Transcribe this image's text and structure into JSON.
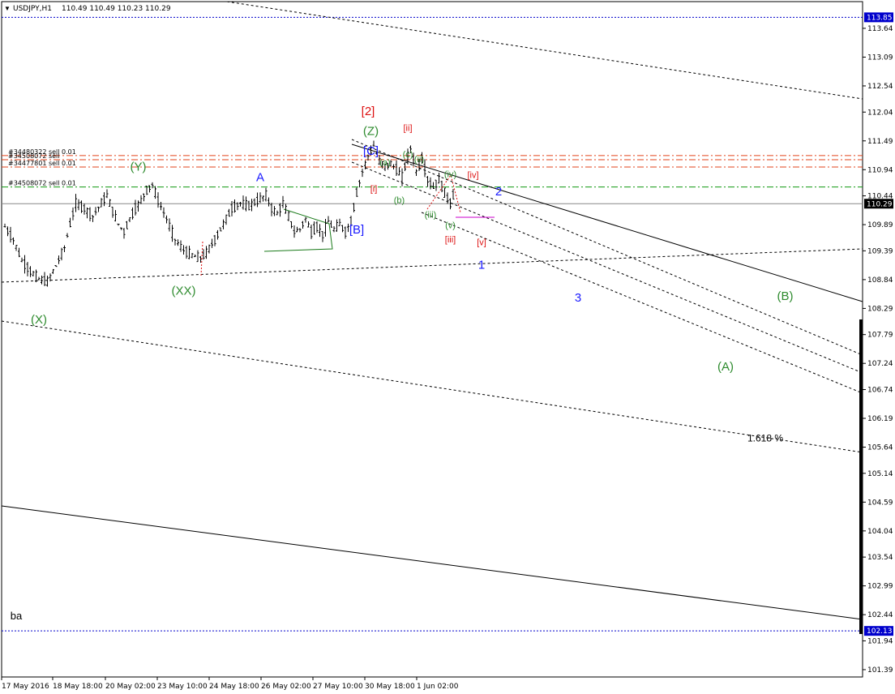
{
  "header": {
    "arrow": "▼",
    "symbol": "USDJPY,H1",
    "ohlc": "110.49 110.49 110.23 110.29"
  },
  "colors": {
    "background": "#ffffff",
    "text": "#000000",
    "price_tag": "#0000cc",
    "wave_green": "#2e8b2e",
    "wave_blue": "#1a1aff",
    "wave_red": "#dd1111",
    "wave_magenta": "#cc00cc",
    "order_line": "#e2431b",
    "order_line_green": "#119911"
  },
  "chart_data": {
    "type": "candlestick",
    "title": "USDJPY,H1",
    "ylim": [
      101.25,
      114.15
    ],
    "y_ticks": [
      "113.64",
      "113.09",
      "112.54",
      "112.04",
      "111.49",
      "110.94",
      "110.44",
      "109.89",
      "109.39",
      "108.84",
      "108.29",
      "107.79",
      "107.24",
      "106.74",
      "106.19",
      "105.64",
      "105.14",
      "104.59",
      "104.04",
      "103.54",
      "102.99",
      "102.44",
      "101.94",
      "101.39"
    ],
    "x_ticks": [
      "17 May 2016",
      "18 May 18:00",
      "20 May 02:00",
      "23 May 10:00",
      "24 May 18:00",
      "26 May 02:00",
      "27 May 10:00",
      "30 May 18:00",
      "1 Jun 02:00"
    ],
    "current_price": "110.29",
    "price_tags": [
      {
        "label": "113.85",
        "value": 113.85
      },
      {
        "label": "110.29",
        "value": 110.29
      },
      {
        "label": "102.13",
        "value": 102.13
      }
    ],
    "orders": [
      {
        "label": "#34480322 sell 0.01",
        "price": 111.21
      },
      {
        "label": "#34508072 sell",
        "price": 111.13
      },
      {
        "label": "#34477801 sell 0.01",
        "price": 110.99
      },
      {
        "label": "#34508072 sell 0.01",
        "price": 110.61
      }
    ],
    "price_path": [
      [
        0,
        109.85
      ],
      [
        3,
        109.6
      ],
      [
        6,
        109.2
      ],
      [
        9,
        109.0
      ],
      [
        12,
        108.85
      ],
      [
        15,
        108.8
      ],
      [
        18,
        109.1
      ],
      [
        21,
        109.45
      ],
      [
        23,
        109.9
      ],
      [
        25,
        110.3
      ],
      [
        28,
        110.2
      ],
      [
        31,
        110.05
      ],
      [
        34,
        110.3
      ],
      [
        36,
        110.45
      ],
      [
        38,
        110.15
      ],
      [
        40,
        109.9
      ],
      [
        42,
        109.75
      ],
      [
        44,
        110.0
      ],
      [
        46,
        110.2
      ],
      [
        48,
        110.35
      ],
      [
        50,
        110.55
      ],
      [
        52,
        110.65
      ],
      [
        54,
        110.35
      ],
      [
        57,
        110.0
      ],
      [
        60,
        109.6
      ],
      [
        63,
        109.4
      ],
      [
        66,
        109.3
      ],
      [
        69,
        109.25
      ],
      [
        71,
        109.35
      ],
      [
        74,
        109.6
      ],
      [
        77,
        109.9
      ],
      [
        80,
        110.2
      ],
      [
        83,
        110.3
      ],
      [
        86,
        110.25
      ],
      [
        89,
        110.35
      ],
      [
        92,
        110.45
      ],
      [
        94,
        110.2
      ],
      [
        96,
        110.1
      ],
      [
        98,
        110.3
      ],
      [
        100,
        110.05
      ],
      [
        102,
        109.75
      ],
      [
        104,
        109.8
      ],
      [
        106,
        110.0
      ],
      [
        108,
        109.75
      ],
      [
        110,
        109.85
      ],
      [
        112,
        109.7
      ],
      [
        114,
        109.95
      ],
      [
        116,
        109.8
      ],
      [
        118,
        109.9
      ],
      [
        120,
        109.75
      ],
      [
        122,
        109.95
      ],
      [
        124,
        110.5
      ],
      [
        126,
        110.9
      ],
      [
        128,
        111.2
      ],
      [
        130,
        111.4
      ],
      [
        132,
        111.1
      ],
      [
        134,
        111.0
      ],
      [
        136,
        111.05
      ],
      [
        138,
        110.95
      ],
      [
        140,
        110.8
      ],
      [
        142,
        111.2
      ],
      [
        143,
        111.35
      ],
      [
        145,
        110.9
      ],
      [
        147,
        111.15
      ],
      [
        149,
        110.75
      ],
      [
        151,
        110.6
      ],
      [
        153,
        110.75
      ],
      [
        155,
        110.5
      ],
      [
        157,
        110.3
      ],
      [
        158,
        110.45
      ]
    ],
    "price_path_x_range": [
      0,
      158
    ],
    "annotations": [
      {
        "text": "[2]",
        "color": "red",
        "size": 15,
        "idx": 128,
        "price": 111.98
      },
      {
        "text": "(Z)",
        "color": "green",
        "size": 15,
        "idx": 129,
        "price": 111.6
      },
      {
        "text": "[C]",
        "color": "blue",
        "size": 15,
        "idx": 129,
        "price": 111.22
      },
      {
        "text": "[ii]",
        "color": "red",
        "size": 11,
        "idx": 142,
        "price": 111.68
      },
      {
        "text": "(c)",
        "color": "green",
        "size": 11,
        "idx": 142,
        "price": 111.18
      },
      {
        "text": "(ii)",
        "color": "green",
        "size": 11,
        "idx": 146,
        "price": 111.08
      },
      {
        "text": "(a)",
        "color": "green",
        "size": 11,
        "idx": 134,
        "price": 111.02
      },
      {
        "text": "(iv)",
        "color": "green",
        "size": 11,
        "idx": 157,
        "price": 110.8
      },
      {
        "text": "[iv]",
        "color": "red",
        "size": 11,
        "idx": 165,
        "price": 110.78
      },
      {
        "text": "[i]",
        "color": "red",
        "size": 11,
        "idx": 130,
        "price": 110.52
      },
      {
        "text": "(b)",
        "color": "green",
        "size": 11,
        "idx": 139,
        "price": 110.3
      },
      {
        "text": "(iii)",
        "color": "green",
        "size": 11,
        "idx": 150,
        "price": 110.02
      },
      {
        "text": "(v)",
        "color": "green",
        "size": 11,
        "idx": 157,
        "price": 109.82
      },
      {
        "text": "[iii]",
        "color": "red",
        "size": 11,
        "idx": 157,
        "price": 109.55
      },
      {
        "text": "[v]",
        "color": "red",
        "size": 11,
        "idx": 168,
        "price": 109.5
      },
      {
        "text": "2",
        "color": "blue",
        "size": 15,
        "idx": 174,
        "price": 110.45
      },
      {
        "text": "1",
        "color": "blue",
        "size": 15,
        "idx": 168,
        "price": 109.05
      },
      {
        "text": "[B]",
        "color": "blue",
        "size": 15,
        "idx": 124,
        "price": 109.72
      },
      {
        "text": "A",
        "color": "blue",
        "size": 15,
        "idx": 90,
        "price": 110.72
      },
      {
        "text": "(Y)",
        "color": "green",
        "size": 15,
        "idx": 47,
        "price": 110.92
      },
      {
        "text": "(XX)",
        "color": "green",
        "size": 15,
        "idx": 63,
        "price": 108.55
      },
      {
        "text": "(X)",
        "color": "green",
        "size": 15,
        "idx": 12,
        "price": 108.0
      },
      {
        "text": "3",
        "color": "blue",
        "size": 15,
        "idx": 202,
        "price": 108.42
      },
      {
        "text": "(B)",
        "color": "green",
        "size": 15,
        "idx": 275,
        "price": 108.45
      },
      {
        "text": "(A)",
        "color": "green",
        "size": 15,
        "idx": 254,
        "price": 107.1
      },
      {
        "text": "1.618 %",
        "color": "black",
        "size": 12,
        "idx": 268,
        "price": 105.75
      },
      {
        "text": "ba",
        "color": "black",
        "size": 13,
        "idx": 4,
        "price": 102.35
      }
    ]
  }
}
